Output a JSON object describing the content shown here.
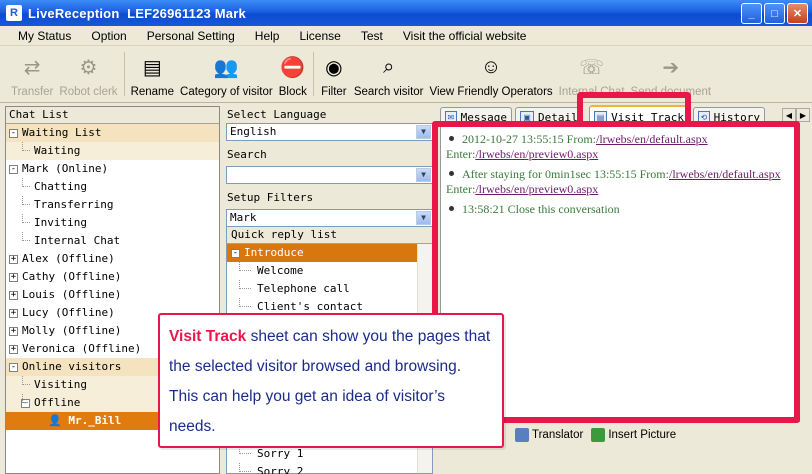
{
  "window": {
    "app_name": "LiveReception",
    "title_rest": "LEF26961123 Mark",
    "app_icon_letter": "R"
  },
  "menu": [
    "My Status",
    "Option",
    "Personal Setting",
    "Help",
    "License",
    "Test",
    "Visit the official website"
  ],
  "toolbar": [
    {
      "label": "Transfer",
      "icon": "transfer-icon",
      "glyph": "⇄",
      "enabled": false
    },
    {
      "label": "Robot clerk",
      "icon": "robot-icon",
      "glyph": "⚙",
      "enabled": false
    },
    {
      "label": "Rename",
      "icon": "rename-icon",
      "glyph": "▤",
      "enabled": true
    },
    {
      "label": "Category of visitor",
      "icon": "category-icon",
      "glyph": "👥",
      "enabled": true
    },
    {
      "label": "Block",
      "icon": "block-icon",
      "glyph": "⛔",
      "enabled": true
    },
    {
      "label": "Filter",
      "icon": "filter-icon",
      "glyph": "◉",
      "enabled": true
    },
    {
      "label": "Search visitor",
      "icon": "search-visitor-icon",
      "glyph": "⌕",
      "enabled": true
    },
    {
      "label": "View Friendly Operators",
      "icon": "operators-icon",
      "glyph": "☺",
      "enabled": true
    },
    {
      "label": "Internal Chat",
      "icon": "internal-chat-icon",
      "glyph": "☏",
      "enabled": false
    },
    {
      "label": "Send document",
      "icon": "send-document-icon",
      "glyph": "➔",
      "enabled": false
    }
  ],
  "chat_list": {
    "header": "Chat List",
    "rows": [
      {
        "text": "Waiting List",
        "level": 0,
        "expander": "-",
        "style": "group"
      },
      {
        "text": "Waiting",
        "level": 1,
        "style": "sub"
      },
      {
        "text": "Mark (Online)",
        "level": 0,
        "expander": "-",
        "style": "plain"
      },
      {
        "text": "Chatting",
        "level": 1,
        "style": "plain"
      },
      {
        "text": "Transferring",
        "level": 1,
        "style": "plain"
      },
      {
        "text": "Inviting",
        "level": 1,
        "style": "plain"
      },
      {
        "text": "Internal Chat",
        "level": 1,
        "style": "plain"
      },
      {
        "text": "Alex (Offline)",
        "level": 0,
        "expander": "+",
        "style": "plain"
      },
      {
        "text": "Cathy (Offline)",
        "level": 0,
        "expander": "+",
        "style": "plain"
      },
      {
        "text": "Louis (Offline)",
        "level": 0,
        "expander": "+",
        "style": "plain"
      },
      {
        "text": "Lucy (Offline)",
        "level": 0,
        "expander": "+",
        "style": "plain"
      },
      {
        "text": "Molly (Offline)",
        "level": 0,
        "expander": "+",
        "style": "plain"
      },
      {
        "text": "Veronica (Offline)",
        "level": 0,
        "expander": "+",
        "style": "plain"
      },
      {
        "text": "Online visitors",
        "level": 0,
        "expander": "-",
        "style": "group"
      },
      {
        "text": "Visiting",
        "level": 1,
        "style": "sub"
      },
      {
        "text": "Offline",
        "level": 1,
        "expander": "-",
        "style": "sub"
      },
      {
        "text": "Mr._Bill",
        "level": 2,
        "style": "selected"
      }
    ]
  },
  "middle": {
    "select_language_label": "Select Language",
    "language_value": "English",
    "search_label": "Search",
    "search_value": "",
    "setup_filters_label": "Setup Filters",
    "filter_value": "Mark",
    "quick_reply_header": "Quick reply list",
    "quick_reply_rows": [
      {
        "text": "Introduce",
        "group": true
      },
      {
        "text": "Welcome",
        "group": false
      },
      {
        "text": "Telephone call",
        "group": false
      },
      {
        "text": "Client's contact",
        "group": false
      }
    ],
    "quick_reply_rows_bottom": [
      "Sorry 1",
      "Sorry 2"
    ]
  },
  "tabs": [
    {
      "label": "Message",
      "active": false
    },
    {
      "label": "Detail",
      "active": false
    },
    {
      "label": "Visit Track",
      "active": true
    },
    {
      "label": "History",
      "active": false
    }
  ],
  "visit_track": [
    {
      "time": "2012-10-27 13:55:15",
      "from_label": "From:",
      "from_link": "/lrwebs/en/default.aspx",
      "enter_label": "Enter:",
      "enter_link": "/lrwebs/en/preview0.aspx",
      "prefix": ""
    },
    {
      "time": "13:55:15",
      "from_label": "From:",
      "from_link": "/lrwebs/en/default.aspx",
      "enter_label": "Enter:",
      "enter_link": "/lrwebs/en/preview0.aspx",
      "prefix": "After staying for 0min1sec"
    },
    {
      "text": "13:58:21 Close this conversation"
    }
  ],
  "bottom_tools": [
    {
      "label": "Translator",
      "icon": "translator-icon",
      "color": "#5a7fc0"
    },
    {
      "label": "Insert Picture",
      "icon": "insert-picture-icon",
      "color": "#3c9a3c"
    }
  ],
  "callout": {
    "keyword": "Visit Track",
    "text": " sheet can show you the pages that the selected visitor browsed and browsing. This can help you get an idea of visitor’s needs."
  },
  "colors": {
    "highlight": "#e8174a",
    "callout_text": "#1a2c8a",
    "track_text": "#3a7a3a",
    "selected_row": "#e07b10"
  }
}
